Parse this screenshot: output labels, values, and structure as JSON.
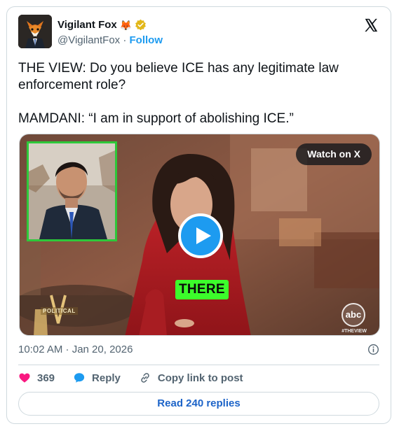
{
  "author": {
    "name": "Vigilant Fox",
    "emoji": "🦊",
    "handle": "@VigilantFox",
    "separator": " · ",
    "follow_label": "Follow"
  },
  "tweet": {
    "text_paragraphs": [
      "THE VIEW: Do you believe ICE has any legitimate law enforcement role?",
      "MAMDANI: “I am in support of abolishing ICE.”"
    ]
  },
  "media": {
    "watch_label": "Watch on X",
    "caption": "THERE",
    "network_logo": "abc",
    "show_tag": "#THEVIEW",
    "overlay_text": "POLITICAL"
  },
  "meta": {
    "timestamp": "10:02 AM · Jan 20, 2026"
  },
  "actions": {
    "likes": "369",
    "reply_label": "Reply",
    "copy_link_label": "Copy link to post"
  },
  "footer": {
    "read_replies_label": "Read 240 replies"
  },
  "icons": {
    "brand": "x-logo-icon",
    "verified": "verified-badge-icon",
    "like": "heart-icon",
    "reply": "reply-bubble-icon",
    "link": "link-icon",
    "info": "info-icon",
    "play": "play-icon"
  },
  "colors": {
    "accent": "#1d9bf0",
    "like": "#f91880",
    "verified": "#e2b719",
    "caption_bg": "#3cfc2b",
    "inset_border": "#2ec83a"
  }
}
